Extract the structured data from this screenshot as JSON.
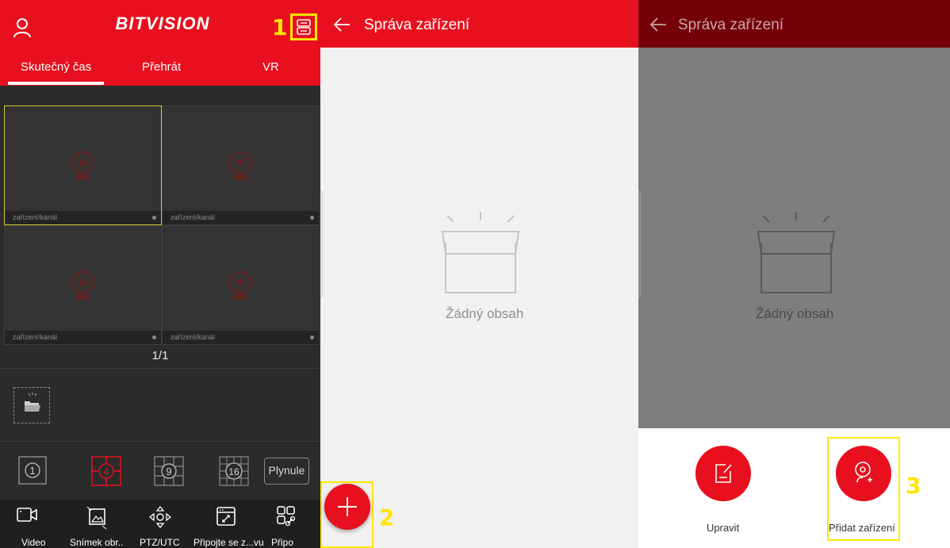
{
  "panel1": {
    "logo": "BITVISION",
    "annotation": "1",
    "tabs": [
      {
        "label": "Skutečný čas",
        "active": true
      },
      {
        "label": "Přehrát",
        "active": false
      },
      {
        "label": "VR",
        "active": false
      }
    ],
    "cells": [
      {
        "label": "zařízení/kanál"
      },
      {
        "label": "zařízení/kanál"
      },
      {
        "label": "zařízení/kanál"
      },
      {
        "label": "zařízení/kanál"
      }
    ],
    "page_indicator": "1/1",
    "layouts": {
      "one": "1",
      "four": "4",
      "nine": "9",
      "sixteen": "16",
      "mode": "Plynule"
    },
    "tools": [
      {
        "label": "Video",
        "icon": "video-icon"
      },
      {
        "label": "Snímek obr..",
        "icon": "snapshot-icon"
      },
      {
        "label": "PTZ/UTC",
        "icon": "ptz-icon"
      },
      {
        "label": "Připojte se z...vu",
        "icon": "connect-icon"
      },
      {
        "label": "Připo",
        "icon": "connect-more-icon"
      }
    ],
    "accent": "#e8101e"
  },
  "panel2": {
    "title": "Správa zařízení",
    "empty_text": "Žádný obsah",
    "annotation": "2"
  },
  "panel3": {
    "title": "Správa zařízení",
    "empty_text": "Žádný obsah",
    "actions": [
      {
        "label": "Upravit",
        "icon": "edit-icon"
      },
      {
        "label": "Přidat zařízení",
        "icon": "add-camera-icon"
      }
    ],
    "annotation": "3"
  },
  "colors": {
    "brand_red": "#e8101e",
    "highlight_yellow": "#ffe600",
    "dark_bg": "#2b2b2b"
  }
}
